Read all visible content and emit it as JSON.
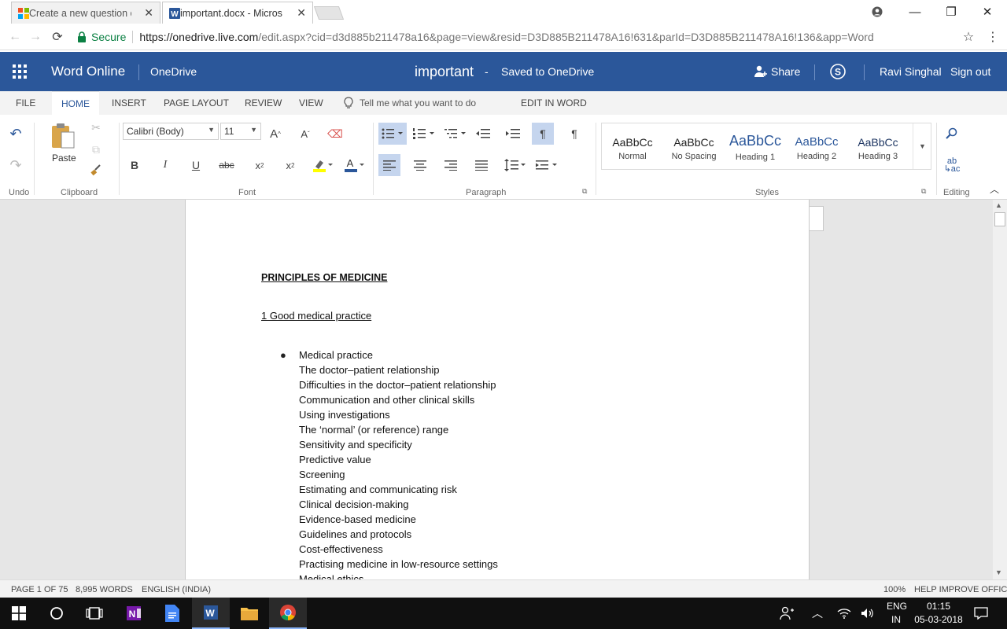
{
  "browser": {
    "tabs": [
      {
        "title": "Create a new question or",
        "active": false
      },
      {
        "title": "important.docx - Microso",
        "active": true
      }
    ],
    "secure_label": "Secure",
    "url_scheme_host": "https://onedrive.live.com",
    "url_path": "/edit.aspx?cid=d3d885b211478a16&page=view&resid=D3D885B211478A16!631&parId=D3D885B211478A16!136&app=Word"
  },
  "header": {
    "app_name": "Word Online",
    "service": "OneDrive",
    "doc_name": "important",
    "dash": "-",
    "save_status": "Saved to OneDrive",
    "share_label": "Share",
    "user_name": "Ravi Singhal",
    "signout_label": "Sign out"
  },
  "ribbon_tabs": {
    "file": "FILE",
    "home": "HOME",
    "insert": "INSERT",
    "page_layout": "PAGE LAYOUT",
    "review": "REVIEW",
    "view": "VIEW",
    "tell_me": "Tell me what you want to do",
    "edit_in_word": "EDIT IN WORD"
  },
  "ribbon": {
    "groups": {
      "undo": "Undo",
      "clipboard": "Clipboard",
      "font": "Font",
      "paragraph": "Paragraph",
      "styles": "Styles",
      "editing": "Editing"
    },
    "paste_label": "Paste",
    "font_name": "Calibri (Body)",
    "font_size": "11",
    "styles": [
      {
        "preview": "AaBbCc",
        "name": "Normal"
      },
      {
        "preview": "AaBbCc",
        "name": "No Spacing"
      },
      {
        "preview": "AaBbCc",
        "name": "Heading 1"
      },
      {
        "preview": "AaBbCc",
        "name": "Heading 2"
      },
      {
        "preview": "AaBbCc",
        "name": "Heading 3"
      }
    ],
    "colors": {
      "accent": "#2b579a",
      "highlight": "#ffff00",
      "font_color": "#2b579a"
    }
  },
  "document": {
    "title": "PRINCIPLES OF MEDICINE",
    "section": "1 Good medical practice",
    "items": [
      "Medical practice",
      "The doctor–patient relationship",
      "Difficulties in the doctor–patient relationship",
      "Communication and other clinical skills",
      "Using investigations",
      "The ‘normal’ (or reference) range",
      "Sensitivity and specificity",
      "Predictive value",
      "Screening",
      "Estimating and communicating risk",
      "Clinical decision-making",
      "Evidence-based medicine",
      "Guidelines and protocols",
      "Cost-effectiveness",
      "Practising medicine in low-resource settings",
      "Medical ethics"
    ]
  },
  "status": {
    "page": "PAGE 1 OF 75",
    "words": "8,995 WORDS",
    "language": "ENGLISH (INDIA)",
    "zoom": "100%",
    "help": "HELP IMPROVE OFFICE"
  },
  "taskbar": {
    "lang_top": "ENG",
    "lang_bottom": "IN",
    "time": "01:15",
    "date": "05-03-2018"
  }
}
